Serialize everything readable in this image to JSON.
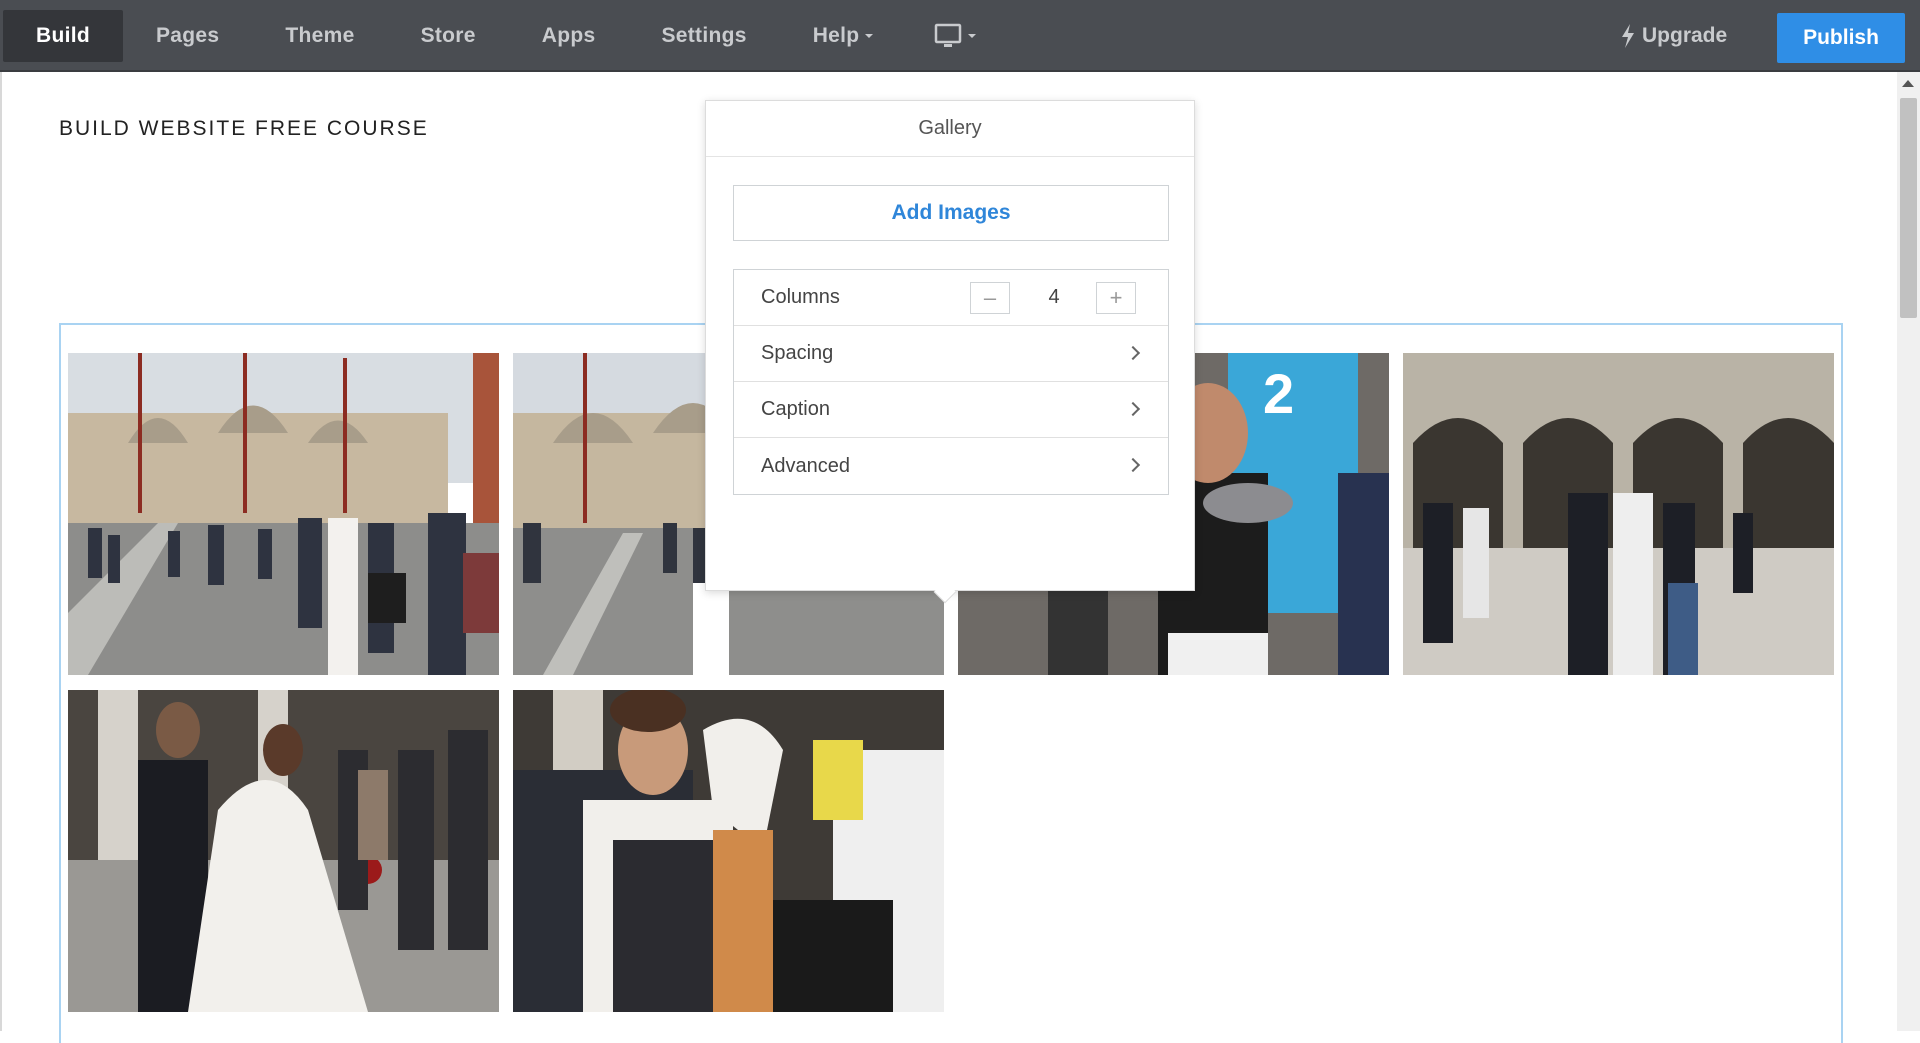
{
  "nav": {
    "items": [
      {
        "label": "Build",
        "active": true
      },
      {
        "label": "Pages"
      },
      {
        "label": "Theme"
      },
      {
        "label": "Store"
      },
      {
        "label": "Apps"
      },
      {
        "label": "Settings"
      },
      {
        "label": "Help",
        "dropdown": true
      }
    ],
    "device_icon": "desktop-monitor-icon",
    "upgrade_label": "Upgrade",
    "upgrade_icon": "lightning-bolt-icon",
    "publish_label": "Publish",
    "colors": {
      "navbar": "#4a4d52",
      "active": "#34363a",
      "publish": "#2f8ee6"
    }
  },
  "site": {
    "title": "BUILD WEBSITE FREE COURSE"
  },
  "gallery_popover": {
    "title": "Gallery",
    "add_images_label": "Add Images",
    "columns_label": "Columns",
    "columns_value": "4",
    "spacing_label": "Spacing",
    "caption_label": "Caption",
    "advanced_label": "Advanced"
  },
  "gallery": {
    "columns": 4,
    "images": [
      {
        "name": "photo-basilica-square"
      },
      {
        "name": "photo-basilica-crowd"
      },
      {
        "name": "photo-woman-pigeons"
      },
      {
        "name": "photo-arcade-couple"
      },
      {
        "name": "photo-bride-groom-square"
      },
      {
        "name": "photo-groom-portrait"
      }
    ]
  }
}
